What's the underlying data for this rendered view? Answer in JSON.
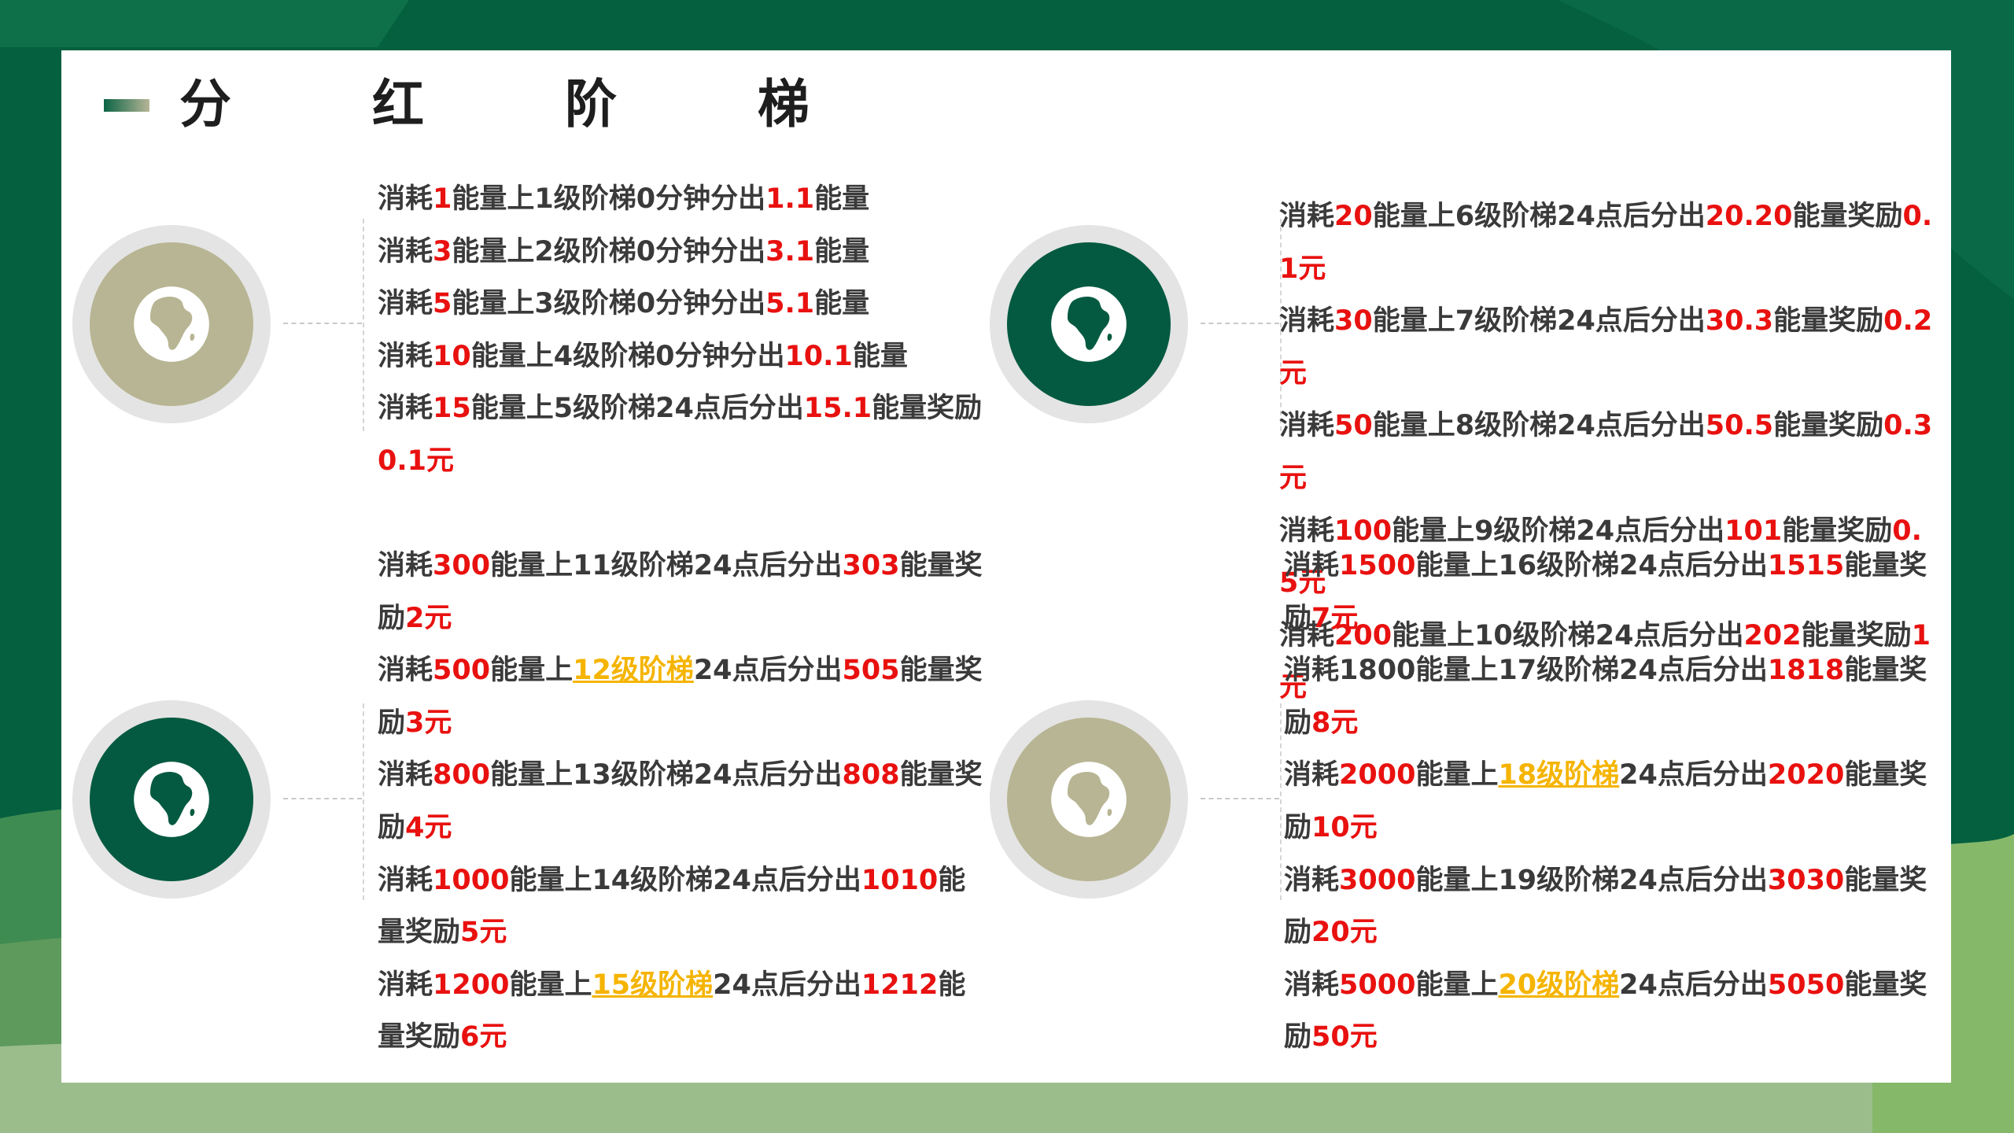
{
  "title": "分  红  阶  梯",
  "colors": {
    "green": "#045a40",
    "olive": "#b8b594",
    "red": "#e8110f",
    "gold": "#f5b400"
  },
  "icons": {
    "circle_icon": "globe-africa-icon"
  },
  "group1": [
    [
      {
        "t": "消耗",
        "c": "n"
      },
      {
        "t": "1",
        "c": "r"
      },
      {
        "t": "能量上1级阶梯0分钟分出",
        "c": "n"
      },
      {
        "t": "1.1",
        "c": "r"
      },
      {
        "t": "能量",
        "c": "n"
      }
    ],
    [
      {
        "t": "消耗",
        "c": "n"
      },
      {
        "t": "3",
        "c": "r"
      },
      {
        "t": "能量上2级阶梯0分钟分出",
        "c": "n"
      },
      {
        "t": "3.1",
        "c": "r"
      },
      {
        "t": "能量",
        "c": "n"
      }
    ],
    [
      {
        "t": "消耗",
        "c": "n"
      },
      {
        "t": "5",
        "c": "r"
      },
      {
        "t": "能量上3级阶梯0分钟分出",
        "c": "n"
      },
      {
        "t": "5.1",
        "c": "r"
      },
      {
        "t": "能量",
        "c": "n"
      }
    ],
    [
      {
        "t": "消耗",
        "c": "n"
      },
      {
        "t": "10",
        "c": "r"
      },
      {
        "t": "能量上4级阶梯0分钟分出",
        "c": "n"
      },
      {
        "t": "10.1",
        "c": "r"
      },
      {
        "t": "能量",
        "c": "n"
      }
    ],
    [
      {
        "t": "消耗",
        "c": "n"
      },
      {
        "t": "15",
        "c": "r"
      },
      {
        "t": "能量上5级阶梯24点后分出",
        "c": "n"
      },
      {
        "t": "15.1",
        "c": "r"
      },
      {
        "t": "能量奖励",
        "c": "n"
      },
      {
        "t": "0.1元",
        "c": "r"
      }
    ]
  ],
  "group2": [
    [
      {
        "t": "消耗",
        "c": "n"
      },
      {
        "t": "20",
        "c": "r"
      },
      {
        "t": "能量上6级阶梯24点后分出",
        "c": "n"
      },
      {
        "t": "20.20",
        "c": "r"
      },
      {
        "t": "能量奖励",
        "c": "n"
      },
      {
        "t": "0.1元",
        "c": "r"
      }
    ],
    [
      {
        "t": "消耗",
        "c": "n"
      },
      {
        "t": "30",
        "c": "r"
      },
      {
        "t": "能量上7级阶梯24点后分出",
        "c": "n"
      },
      {
        "t": "30.3",
        "c": "r"
      },
      {
        "t": "能量奖励",
        "c": "n"
      },
      {
        "t": "0.2元",
        "c": "r"
      }
    ],
    [
      {
        "t": "消耗",
        "c": "n"
      },
      {
        "t": "50",
        "c": "r"
      },
      {
        "t": "能量上8级阶梯24点后分出",
        "c": "n"
      },
      {
        "t": "50.5",
        "c": "r"
      },
      {
        "t": "能量奖励",
        "c": "n"
      },
      {
        "t": "0.3元",
        "c": "r"
      }
    ],
    [
      {
        "t": "消耗",
        "c": "n"
      },
      {
        "t": "100",
        "c": "r"
      },
      {
        "t": "能量上9级阶梯24点后分出",
        "c": "n"
      },
      {
        "t": "101",
        "c": "r"
      },
      {
        "t": "能量奖励",
        "c": "n"
      },
      {
        "t": "0.5元",
        "c": "r"
      }
    ],
    [
      {
        "t": "消耗",
        "c": "n"
      },
      {
        "t": "200",
        "c": "r"
      },
      {
        "t": "能量上10级阶梯24点后分出",
        "c": "n"
      },
      {
        "t": "202",
        "c": "r"
      },
      {
        "t": "能量奖励",
        "c": "n"
      },
      {
        "t": "1元",
        "c": "r"
      }
    ]
  ],
  "group3": [
    [
      {
        "t": "消耗",
        "c": "n"
      },
      {
        "t": "300",
        "c": "r"
      },
      {
        "t": "能量上11级阶梯24点后分出",
        "c": "n"
      },
      {
        "t": "303",
        "c": "r"
      },
      {
        "t": "能量奖励",
        "c": "n"
      },
      {
        "t": "2元",
        "c": "r"
      }
    ],
    [
      {
        "t": "消耗",
        "c": "n"
      },
      {
        "t": "500",
        "c": "r"
      },
      {
        "t": "能量上",
        "c": "n"
      },
      {
        "t": "12级阶梯",
        "c": "y"
      },
      {
        "t": "24点后分出",
        "c": "n"
      },
      {
        "t": "505",
        "c": "r"
      },
      {
        "t": "能量奖励",
        "c": "n"
      },
      {
        "t": "3元",
        "c": "r"
      }
    ],
    [
      {
        "t": "消耗",
        "c": "n"
      },
      {
        "t": "800",
        "c": "r"
      },
      {
        "t": "能量上13级阶梯24点后分出",
        "c": "n"
      },
      {
        "t": "808",
        "c": "r"
      },
      {
        "t": "能量奖励",
        "c": "n"
      },
      {
        "t": "4元",
        "c": "r"
      }
    ],
    [
      {
        "t": "消耗",
        "c": "n"
      },
      {
        "t": "1000",
        "c": "r"
      },
      {
        "t": "能量上14级阶梯24点后分出",
        "c": "n"
      },
      {
        "t": "1010",
        "c": "r"
      },
      {
        "t": "能量奖励",
        "c": "n"
      },
      {
        "t": "5元",
        "c": "r"
      }
    ],
    [
      {
        "t": "消耗",
        "c": "n"
      },
      {
        "t": "1200",
        "c": "r"
      },
      {
        "t": "能量上",
        "c": "n"
      },
      {
        "t": "15级阶梯",
        "c": "y"
      },
      {
        "t": "24点后分出",
        "c": "n"
      },
      {
        "t": "1212",
        "c": "r"
      },
      {
        "t": "能量奖励",
        "c": "n"
      },
      {
        "t": "6元",
        "c": "r"
      }
    ]
  ],
  "group4": [
    [
      {
        "t": "消耗",
        "c": "n"
      },
      {
        "t": "1500",
        "c": "r"
      },
      {
        "t": "能量上16级阶梯24点后分出",
        "c": "n"
      },
      {
        "t": "1515",
        "c": "r"
      },
      {
        "t": "能量奖励",
        "c": "n"
      },
      {
        "t": "7元",
        "c": "r"
      }
    ],
    [
      {
        "t": "消耗1800能量上17级阶梯24点后分出",
        "c": "n"
      },
      {
        "t": "1818",
        "c": "r"
      },
      {
        "t": "能量奖励",
        "c": "n"
      },
      {
        "t": "8元",
        "c": "r"
      }
    ],
    [
      {
        "t": "消耗",
        "c": "n"
      },
      {
        "t": "2000",
        "c": "r"
      },
      {
        "t": "能量上",
        "c": "n"
      },
      {
        "t": "18级阶梯",
        "c": "y"
      },
      {
        "t": "24点后分出",
        "c": "n"
      },
      {
        "t": "2020",
        "c": "r"
      },
      {
        "t": "能量奖励",
        "c": "n"
      },
      {
        "t": "10元",
        "c": "r"
      }
    ],
    [
      {
        "t": "消耗",
        "c": "n"
      },
      {
        "t": "3000",
        "c": "r"
      },
      {
        "t": "能量上19级阶梯24点后分出",
        "c": "n"
      },
      {
        "t": "3030",
        "c": "r"
      },
      {
        "t": "能量奖励",
        "c": "n"
      },
      {
        "t": "20元",
        "c": "r"
      }
    ],
    [
      {
        "t": "消耗",
        "c": "n"
      },
      {
        "t": "5000",
        "c": "r"
      },
      {
        "t": "能量上",
        "c": "n"
      },
      {
        "t": "20级阶梯",
        "c": "y"
      },
      {
        "t": "24点后分出",
        "c": "n"
      },
      {
        "t": "5050",
        "c": "r"
      },
      {
        "t": "能量奖励",
        "c": "n"
      },
      {
        "t": "50元",
        "c": "r"
      }
    ]
  ]
}
